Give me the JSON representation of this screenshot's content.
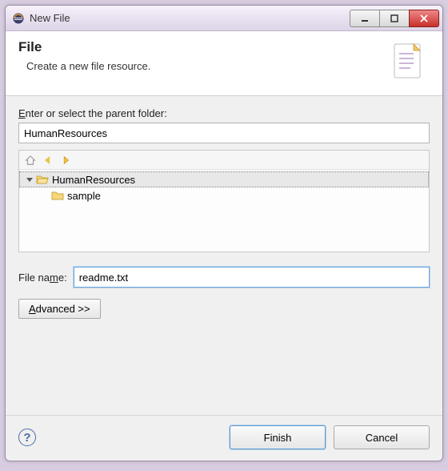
{
  "window": {
    "title": "New File"
  },
  "header": {
    "heading": "File",
    "description": "Create a new file resource."
  },
  "form": {
    "parent_folder_label_pre": "E",
    "parent_folder_label_rest": "nter or select the parent folder:",
    "parent_folder_value": "HumanResources",
    "filename_label_pre": "File na",
    "filename_label_ul": "m",
    "filename_label_post": "e:",
    "filename_value": "readme.txt",
    "advanced_label_pre": "A",
    "advanced_label_rest": "dvanced >>"
  },
  "tree": {
    "items": [
      {
        "label": "HumanResources",
        "depth": 0,
        "expanded": true,
        "selected": true,
        "icon": "folder-open"
      },
      {
        "label": "sample",
        "depth": 1,
        "expanded": false,
        "selected": false,
        "icon": "folder"
      }
    ]
  },
  "footer": {
    "finish_label": "Finish",
    "cancel_label": "Cancel"
  }
}
